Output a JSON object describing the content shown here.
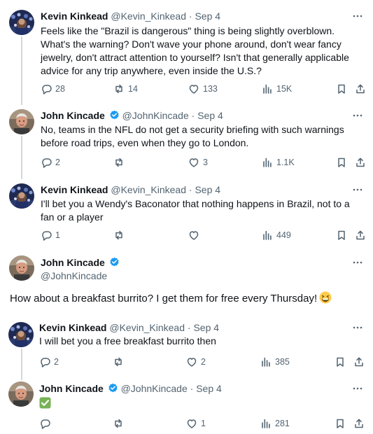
{
  "tweets": [
    {
      "name": "Kevin Kinkead",
      "handle": "@Kevin_Kinkead",
      "date": "Sep 4",
      "text": "Feels like the \"Brazil is dangerous\" thing is being slightly overblown. What's the warning? Don't wave your phone around, don't wear fancy jewelry, don't attract attention to yourself? Isn't that generally applicable advice for any trip anywhere, even inside the U.S.?",
      "replies": "28",
      "retweets": "14",
      "likes": "133",
      "views": "15K"
    },
    {
      "name": "John Kincade",
      "handle": "@JohnKincade",
      "date": "Sep 4",
      "text": "No, teams in the NFL do not get a security briefing with such warnings before road trips, even when they go to London.",
      "replies": "2",
      "retweets": "",
      "likes": "3",
      "views": "1.1K"
    },
    {
      "name": "Kevin Kinkead",
      "handle": "@Kevin_Kinkead",
      "date": "Sep 4",
      "text": "I'll bet you a Wendy's Baconator that nothing happens in Brazil, not to a fan or a player",
      "replies": "1",
      "retweets": "",
      "likes": "",
      "views": "449"
    },
    {
      "name": "John Kincade",
      "handle": "@JohnKincade",
      "text": "How about a breakfast burrito? I get them for free every Thursday!",
      "emoji": "grinning-squinting-face"
    },
    {
      "name": "Kevin Kinkead",
      "handle": "@Kevin_Kinkead",
      "date": "Sep 4",
      "text": "I will bet you a free breakfast burrito then",
      "replies": "2",
      "retweets": "",
      "likes": "2",
      "views": "385"
    },
    {
      "name": "John Kincade",
      "handle": "@JohnKincade",
      "date": "Sep 4",
      "emoji": "check-mark-button",
      "replies": "",
      "retweets": "",
      "likes": "1",
      "views": "281"
    }
  ],
  "separator": "·",
  "colors": {
    "verified": "#1d9bf0",
    "muted": "#536471",
    "text": "#0f1419",
    "thread_line": "#cfd9de",
    "check_emoji": "#5cb85c"
  }
}
